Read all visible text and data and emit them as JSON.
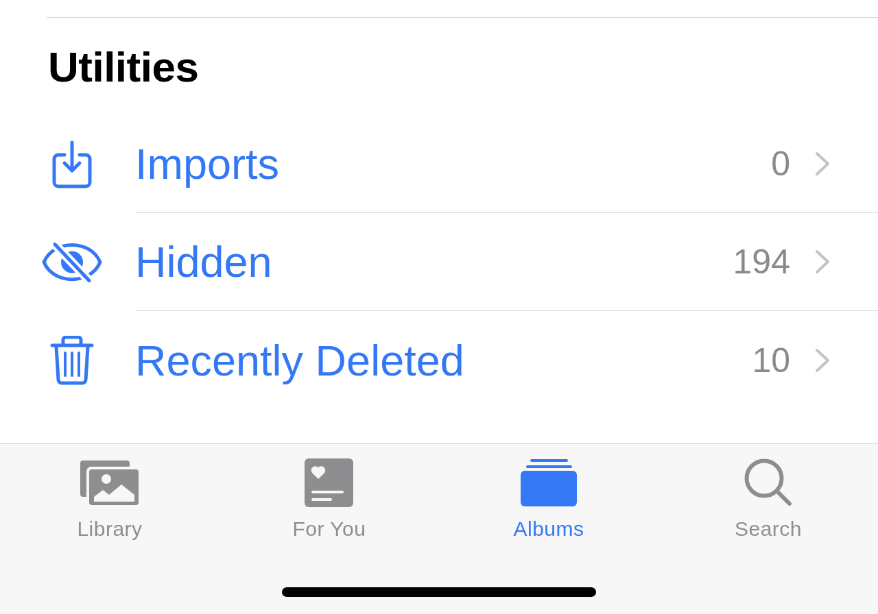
{
  "section": {
    "title": "Utilities"
  },
  "items": [
    {
      "label": "Imports",
      "count": "0"
    },
    {
      "label": "Hidden",
      "count": "194"
    },
    {
      "label": "Recently Deleted",
      "count": "10"
    }
  ],
  "tab_bar": {
    "tabs": [
      {
        "label": "Library",
        "selected": false
      },
      {
        "label": "For You",
        "selected": false
      },
      {
        "label": "Albums",
        "selected": true
      },
      {
        "label": "Search",
        "selected": false
      }
    ]
  }
}
